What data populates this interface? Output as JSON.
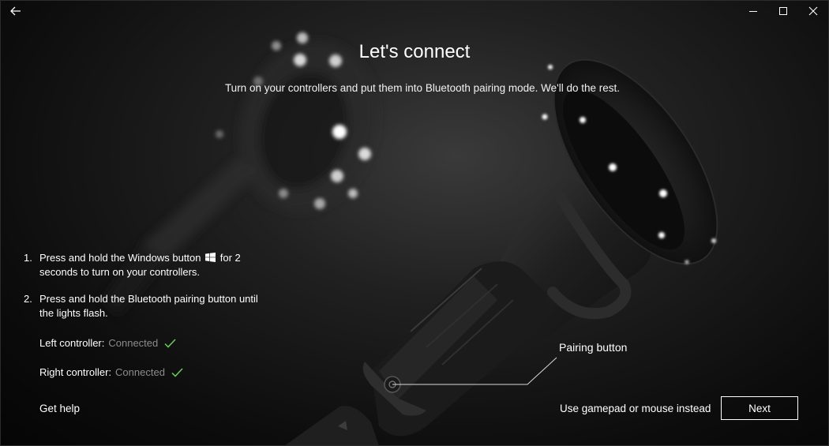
{
  "window": {
    "back_icon": "back-arrow-icon",
    "minimize_icon": "minimize-icon",
    "maximize_icon": "maximize-icon",
    "close_icon": "close-icon",
    "accent_color": "#3a6ea5"
  },
  "header": {
    "title": "Let's connect",
    "subtitle": "Turn on your controllers and put them into Bluetooth pairing mode. We'll do the rest."
  },
  "steps": [
    {
      "number": "1.",
      "text_before": "Press and hold the Windows button",
      "icon": "windows-logo-icon",
      "text_after": "for 2 seconds to turn on your controllers."
    },
    {
      "number": "2.",
      "text": "Press and hold the Bluetooth pairing button until the lights flash."
    }
  ],
  "status": {
    "left": {
      "label": "Left controller:",
      "value": "Connected",
      "icon": "checkmark-icon"
    },
    "right": {
      "label": "Right controller:",
      "value": "Connected",
      "icon": "checkmark-icon"
    },
    "check_color": "#6ccb5f"
  },
  "callout": {
    "label": "Pairing button"
  },
  "footer": {
    "help_link": "Get help",
    "alternate_link": "Use gamepad or mouse instead",
    "next_button": "Next"
  }
}
